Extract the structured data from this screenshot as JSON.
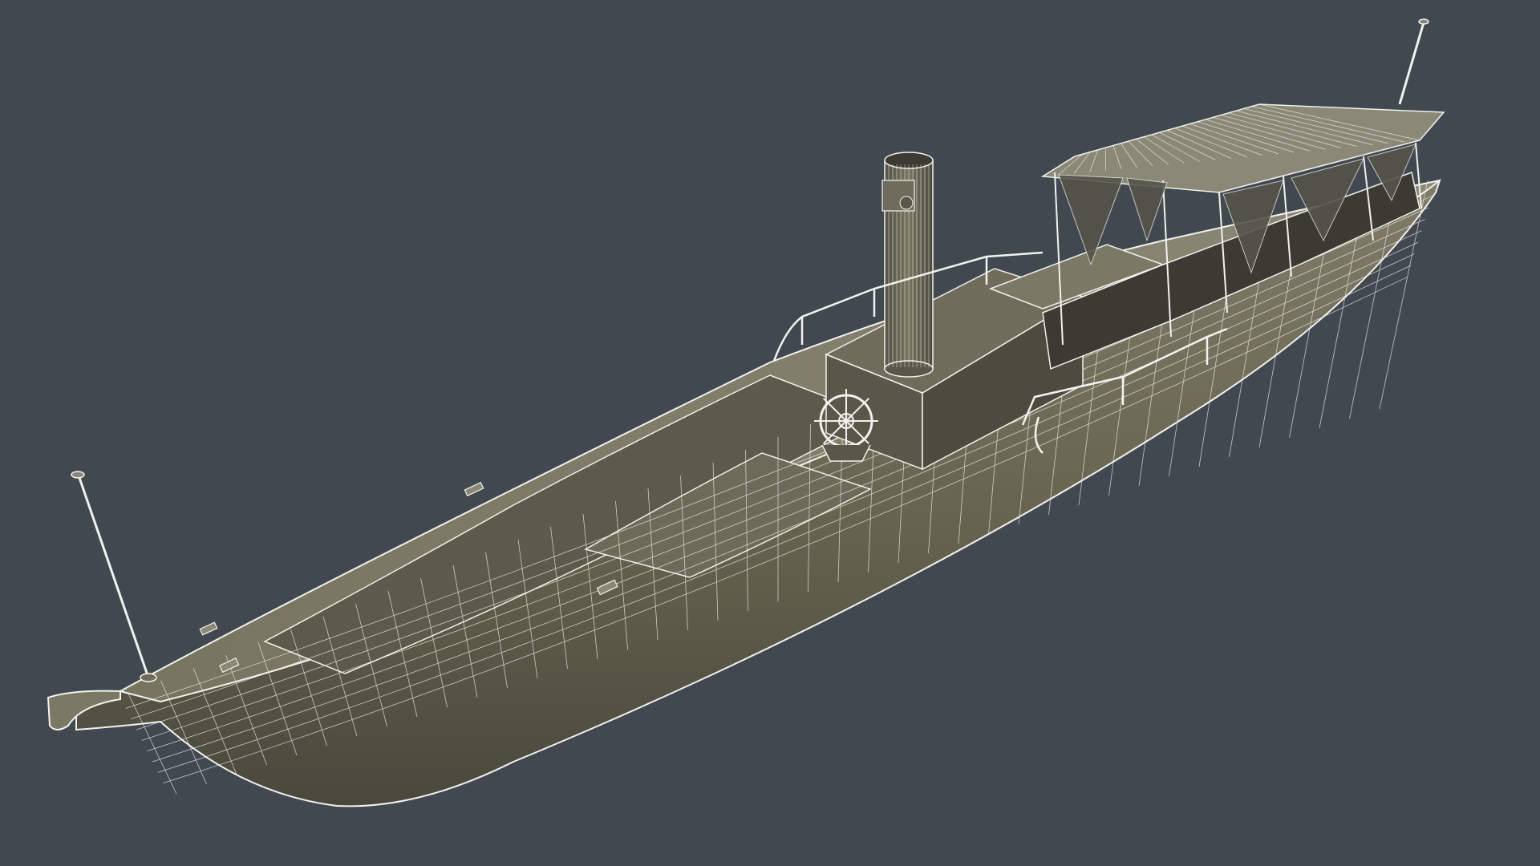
{
  "scene": {
    "background": "#414850",
    "hull_fill": "#6f6c5c",
    "hull_dark": "#4d4b40",
    "deck_fill": "#7b7866",
    "interior_fill": "#5d5a4c",
    "wire_color": "#f2f2ee",
    "cabin_fill": "#58574a",
    "roof_fill": "#8b8877",
    "shading_fill": "#3c3b33"
  },
  "icons": {
    "model": "steam-launch-wireframe-icon",
    "wheel": "ship-wheel-icon",
    "funnel": "smokestack-icon"
  }
}
